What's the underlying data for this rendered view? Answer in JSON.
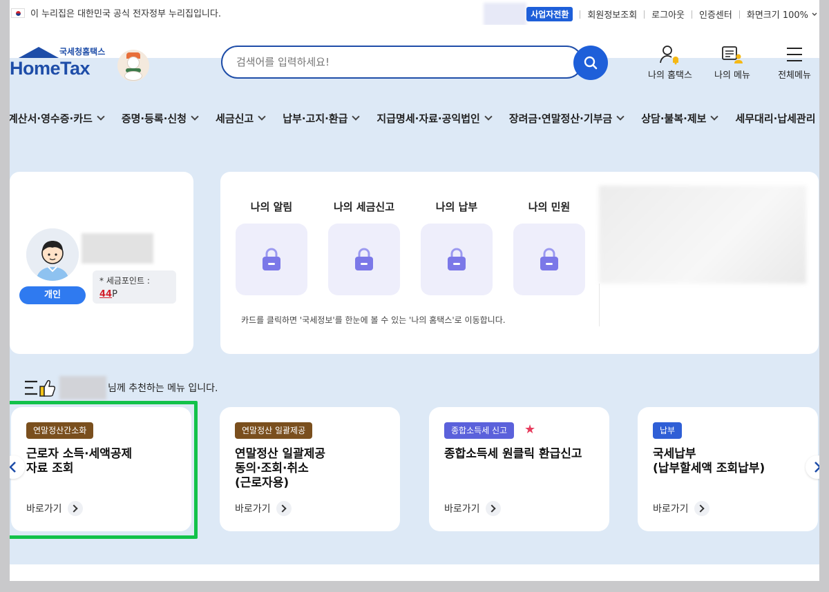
{
  "util_bar": {
    "gov_notice": "이 누리집은 대한민국 공식 전자정부 누리집입니다.",
    "business_switch": "사업자전환",
    "links": [
      "회원정보조회",
      "로그아웃",
      "인증센터",
      "화면크기 100%"
    ]
  },
  "header": {
    "logo_sub": "국세청홈택스",
    "logo_main": "HomeTax",
    "search_placeholder": "검색어를 입력하세요!",
    "icons": [
      {
        "label": "나의 홈택스",
        "icon": "user-bell-icon"
      },
      {
        "label": "나의 메뉴",
        "icon": "menu-user-icon"
      },
      {
        "label": "전체메뉴",
        "icon": "hamburger-icon"
      }
    ]
  },
  "gnb": [
    "계산서·영수증·카드",
    "증명·등록·신청",
    "세금신고",
    "납부·고지·환급",
    "지급명세·자료·공익법인",
    "장려금·연말정산·기부금",
    "상담·불복·제보",
    "세무대리·납세관리"
  ],
  "profile": {
    "badge": "개인",
    "points_label": "* 세금포인트 :",
    "points_value": "44",
    "points_unit": "P"
  },
  "info": {
    "tiles": [
      "나의 알림",
      "나의 세금신고",
      "나의 납부",
      "나의 민원"
    ],
    "note": "카드를 클릭하면 '국세정보'를 한눈에 볼 수 있는 '나의 홈택스'로 이동합니다."
  },
  "recommend": {
    "text": "님께 추천하는 메뉴 입니다."
  },
  "cards": [
    {
      "tag": "연말정산간소화",
      "tag_color": "#7a4f1e",
      "title": "근로자 소득·세액공제\n자료 조회",
      "go": "바로가기",
      "star": false
    },
    {
      "tag": "연말정산 일괄제공",
      "tag_color": "#7a4f1e",
      "title": "연말정산 일괄제공\n동의·조회·취소\n(근로자용)",
      "go": "바로가기",
      "star": false
    },
    {
      "tag": "종합소득세 신고",
      "tag_color": "#5b61db",
      "title": "종합소득세 원클릭 환급신고",
      "go": "바로가기",
      "star": true
    },
    {
      "tag": "납부",
      "tag_color": "#2f5fd6",
      "title": "국세납부\n(납부할세액 조회납부)",
      "go": "바로가기",
      "star": false
    }
  ],
  "colors": {
    "brand": "#1e4da8",
    "accent": "#1e5fd9",
    "highlight": "#12c24a",
    "background": "#dde9f6"
  }
}
